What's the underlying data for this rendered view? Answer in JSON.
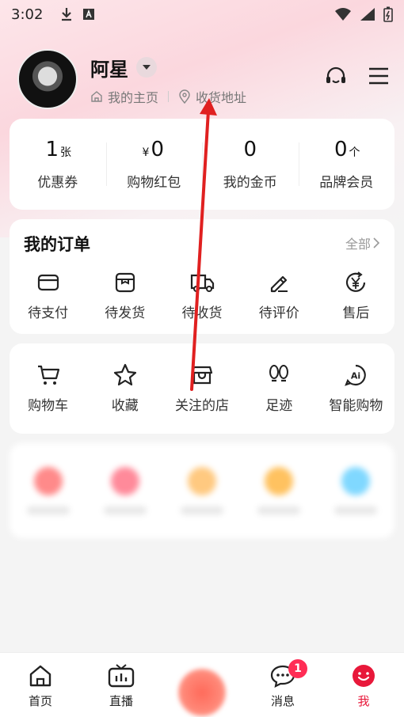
{
  "status_bar": {
    "time": "3:02"
  },
  "profile": {
    "username": "阿星",
    "homepage_link": "我的主页",
    "address_link": "收货地址"
  },
  "assets": [
    {
      "value": "1",
      "unit": "张",
      "prefix": "",
      "label": "优惠券"
    },
    {
      "value": "0",
      "unit": "",
      "prefix": "¥",
      "label": "购物红包"
    },
    {
      "value": "0",
      "unit": "",
      "prefix": "",
      "label": "我的金币"
    },
    {
      "value": "0",
      "unit": "个",
      "prefix": "",
      "label": "品牌会员"
    }
  ],
  "orders": {
    "title": "我的订单",
    "all_label": "全部",
    "items": [
      {
        "label": "待支付",
        "icon": "wallet-icon"
      },
      {
        "label": "待发货",
        "icon": "package-icon"
      },
      {
        "label": "待收货",
        "icon": "truck-icon"
      },
      {
        "label": "待评价",
        "icon": "pen-icon"
      },
      {
        "label": "售后",
        "icon": "refund-icon"
      }
    ]
  },
  "tools": [
    {
      "label": "购物车",
      "icon": "cart-icon"
    },
    {
      "label": "收藏",
      "icon": "star-icon"
    },
    {
      "label": "关注的店",
      "icon": "store-icon"
    },
    {
      "label": "足迹",
      "icon": "footprint-icon"
    },
    {
      "label": "智能购物",
      "icon": "ai-icon"
    }
  ],
  "tabbar": {
    "items": [
      {
        "label": "首页",
        "icon": "home-icon"
      },
      {
        "label": "直播",
        "icon": "tv-icon"
      },
      {
        "label": "",
        "icon": "center-action-icon"
      },
      {
        "label": "消息",
        "icon": "message-icon",
        "badge": "1"
      },
      {
        "label": "我",
        "icon": "smile-icon",
        "active": true
      }
    ]
  },
  "colors": {
    "accent": "#e8183a",
    "badge": "#ff2d55",
    "annotation_arrow": "#e02020"
  }
}
